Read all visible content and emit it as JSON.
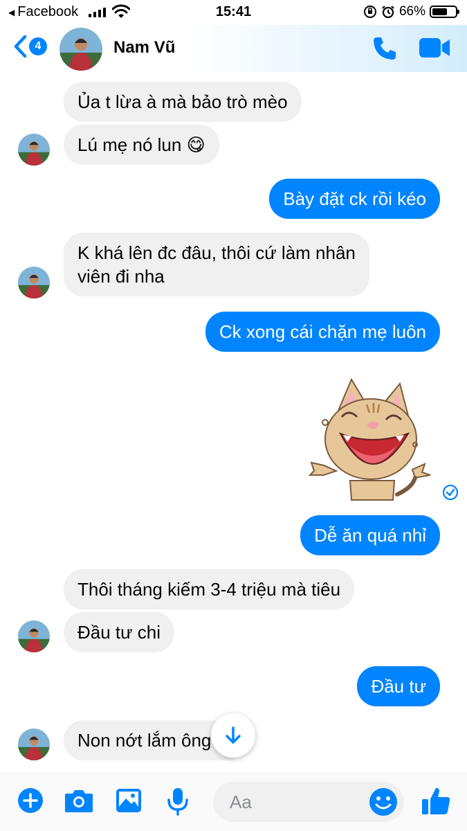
{
  "status_bar": {
    "back_app": "Facebook",
    "time": "15:41",
    "battery": "66%",
    "battery_level": 0.66
  },
  "header": {
    "badge_count": "4",
    "contact_name": "Nam Vũ",
    "icons": [
      "chevron-left-icon",
      "phone-icon",
      "video-camera-icon"
    ]
  },
  "messages": [
    {
      "side": "in",
      "text": "Ủa t lừa à mà bảo trò mèo"
    },
    {
      "side": "in",
      "text": "Lú mẹ nó lun",
      "emoji": "😋"
    },
    {
      "side": "out",
      "text": "Bày đặt ck rồi kéo"
    },
    {
      "side": "in",
      "line1": "K khá lên đc đâu, thôi cứ làm nhân",
      "line2": "viên đi nha"
    },
    {
      "side": "out",
      "text": "Ck xong cái chặn mẹ luôn"
    },
    {
      "side": "out",
      "type": "sticker",
      "sticker": "laughing-cat-sticker"
    },
    {
      "side": "out",
      "text": "Dễ ăn quá nhỉ"
    },
    {
      "side": "in",
      "text": "Thôi tháng kiếm 3-4 triệu mà tiêu"
    },
    {
      "side": "in",
      "text": "Đầu tư chi"
    },
    {
      "side": "out",
      "text": "Đầu tư"
    },
    {
      "side": "in",
      "text": "Non nớt lắm ông"
    }
  ],
  "composer": {
    "placeholder": "Aa",
    "icons": [
      "plus-icon",
      "camera-icon",
      "image-icon",
      "microphone-icon",
      "emoji-icon",
      "thumbs-up-icon"
    ]
  },
  "colors": {
    "accent": "#0084ff",
    "incoming_bubble": "#f0f0f0",
    "outgoing_bubble": "#0084ff"
  }
}
